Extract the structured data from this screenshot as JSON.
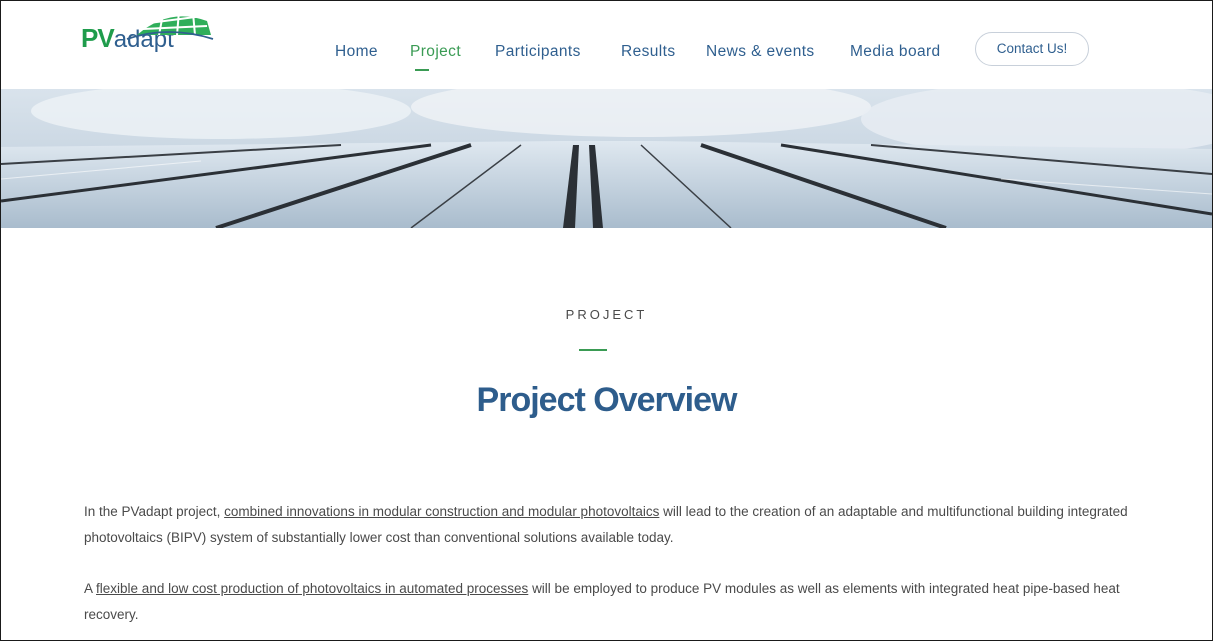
{
  "logo": {
    "pv": "PV",
    "adapt": "adapt"
  },
  "nav": [
    {
      "label": "Home"
    },
    {
      "label": "Project"
    },
    {
      "label": "Participants"
    },
    {
      "label": "Results"
    },
    {
      "label": "News & events"
    },
    {
      "label": "Media board"
    }
  ],
  "contact_label": "Contact Us!",
  "active_nav": "Project",
  "section": {
    "eyebrow": "PROJECT",
    "title": "Project Overview"
  },
  "paragraphs": {
    "p1_prefix": "In the PVadapt project,",
    "p1_link": "combined innovations in modular construction and modular photovoltaics",
    "p1_suffix": "will lead to the creation of an adaptable and multifunctional building integrated photovoltaics (BIPV) system of substantially lower cost than conventional solutions available today.",
    "p2_prefix": "A",
    "p2_link": "flexible and low cost production of photovoltaics in automated processes",
    "p2_suffix": "will be employed to produce PV modules as well as elements with integrated heat pipe-based heat recovery."
  },
  "colors": {
    "brand_green": "#1f9c4c",
    "brand_blue": "#2f5f8f",
    "accent_green": "#3a9b54"
  }
}
